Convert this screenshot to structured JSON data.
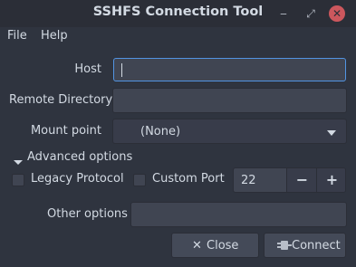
{
  "window": {
    "title": "SSHFS Connection Tool",
    "controls": [
      "minimize-icon",
      "maximize-icon",
      "close-icon"
    ]
  },
  "menubar": {
    "file": "File",
    "help": "Help"
  },
  "form": {
    "host_label": "Host",
    "host_value": "",
    "remote_dir_label": "Remote Directory",
    "remote_dir_value": "",
    "mount_point_label": "Mount point",
    "mount_point_value": "(None)",
    "advanced_label": "Advanced options",
    "legacy_label": "Legacy Protocol",
    "legacy_checked": false,
    "custom_port_label": "Custom Port",
    "custom_port_checked": false,
    "port_value": "22",
    "other_options_label": "Other options",
    "other_options_value": ""
  },
  "buttons": {
    "close": "Close",
    "connect": "Connect"
  },
  "colors": {
    "background": "#2f343f",
    "accent": "#5294e2",
    "close_button": "#cc575d"
  }
}
